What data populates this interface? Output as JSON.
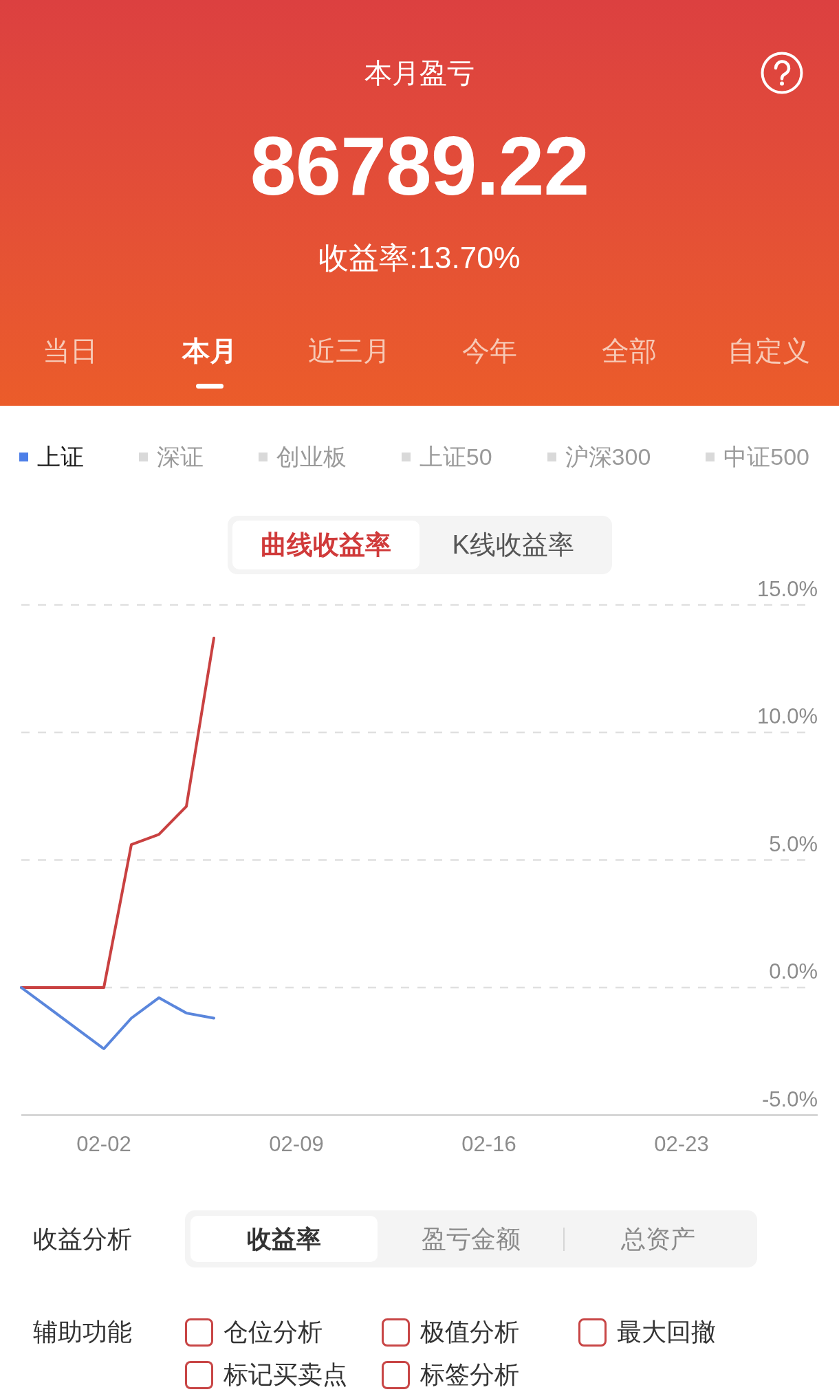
{
  "header": {
    "title": "本月盈亏",
    "amount": "86789.22",
    "rate": "收益率:13.70%"
  },
  "period_tabs": [
    {
      "label": "当日",
      "selected": false
    },
    {
      "label": "本月",
      "selected": true
    },
    {
      "label": "近三月",
      "selected": false
    },
    {
      "label": "今年",
      "selected": false
    },
    {
      "label": "全部",
      "selected": false
    },
    {
      "label": "自定义",
      "selected": false
    }
  ],
  "index_options": [
    {
      "label": "上证",
      "selected": true
    },
    {
      "label": "深证",
      "selected": false
    },
    {
      "label": "创业板",
      "selected": false
    },
    {
      "label": "上证50",
      "selected": false
    },
    {
      "label": "沪深300",
      "selected": false
    },
    {
      "label": "中证500",
      "selected": false
    }
  ],
  "chart_mode_toggle": [
    {
      "label": "曲线收益率",
      "selected": true
    },
    {
      "label": "K线收益率",
      "selected": false
    }
  ],
  "chart": {
    "chart_data": {
      "type": "line",
      "grid": true,
      "categories": [
        null,
        null,
        null,
        "02-02",
        null,
        null,
        null,
        null,
        null,
        null,
        "02-09",
        null,
        null,
        null,
        null,
        null,
        null,
        "02-16",
        null,
        null,
        null,
        null,
        null,
        null,
        "02-23",
        null,
        null,
        null,
        null,
        null
      ],
      "ylim": [
        -5,
        15
      ],
      "yticks": [
        {
          "value": 15,
          "label": "15.0%"
        },
        {
          "value": 10,
          "label": "10.0%"
        },
        {
          "value": 5,
          "label": "5.0%"
        },
        {
          "value": 0,
          "label": "0.0%"
        },
        {
          "value": -5,
          "label": "-5.0%"
        }
      ],
      "series": [
        {
          "color": "#c94141",
          "values": [
            0,
            0,
            0,
            0,
            5.6,
            6.0,
            7.1,
            13.7,
            null,
            null,
            null,
            null,
            null,
            null,
            null,
            null,
            null,
            null,
            null,
            null,
            null,
            null,
            null,
            null,
            null,
            null,
            null,
            null,
            null,
            null
          ]
        },
        {
          "color": "#5a86dc",
          "values": [
            0,
            -0.8,
            -1.6,
            -2.4,
            -1.2,
            -0.4,
            -1.0,
            -1.2,
            null,
            null,
            null,
            null,
            null,
            null,
            null,
            null,
            null,
            null,
            null,
            null,
            null,
            null,
            null,
            null,
            null,
            null,
            null,
            null,
            null,
            null
          ]
        }
      ]
    }
  },
  "analysis": {
    "label": "收益分析",
    "options": [
      {
        "label": "收益率",
        "selected": true
      },
      {
        "label": "盈亏金额",
        "selected": false
      },
      {
        "label": "总资产",
        "selected": false
      }
    ]
  },
  "auxiliary": {
    "label": "辅助功能",
    "options": [
      {
        "label": "仓位分析",
        "checked": false
      },
      {
        "label": "极值分析",
        "checked": false
      },
      {
        "label": "最大回撤",
        "checked": false
      },
      {
        "label": "标记买卖点",
        "checked": false
      },
      {
        "label": "标签分析",
        "checked": false
      }
    ]
  }
}
